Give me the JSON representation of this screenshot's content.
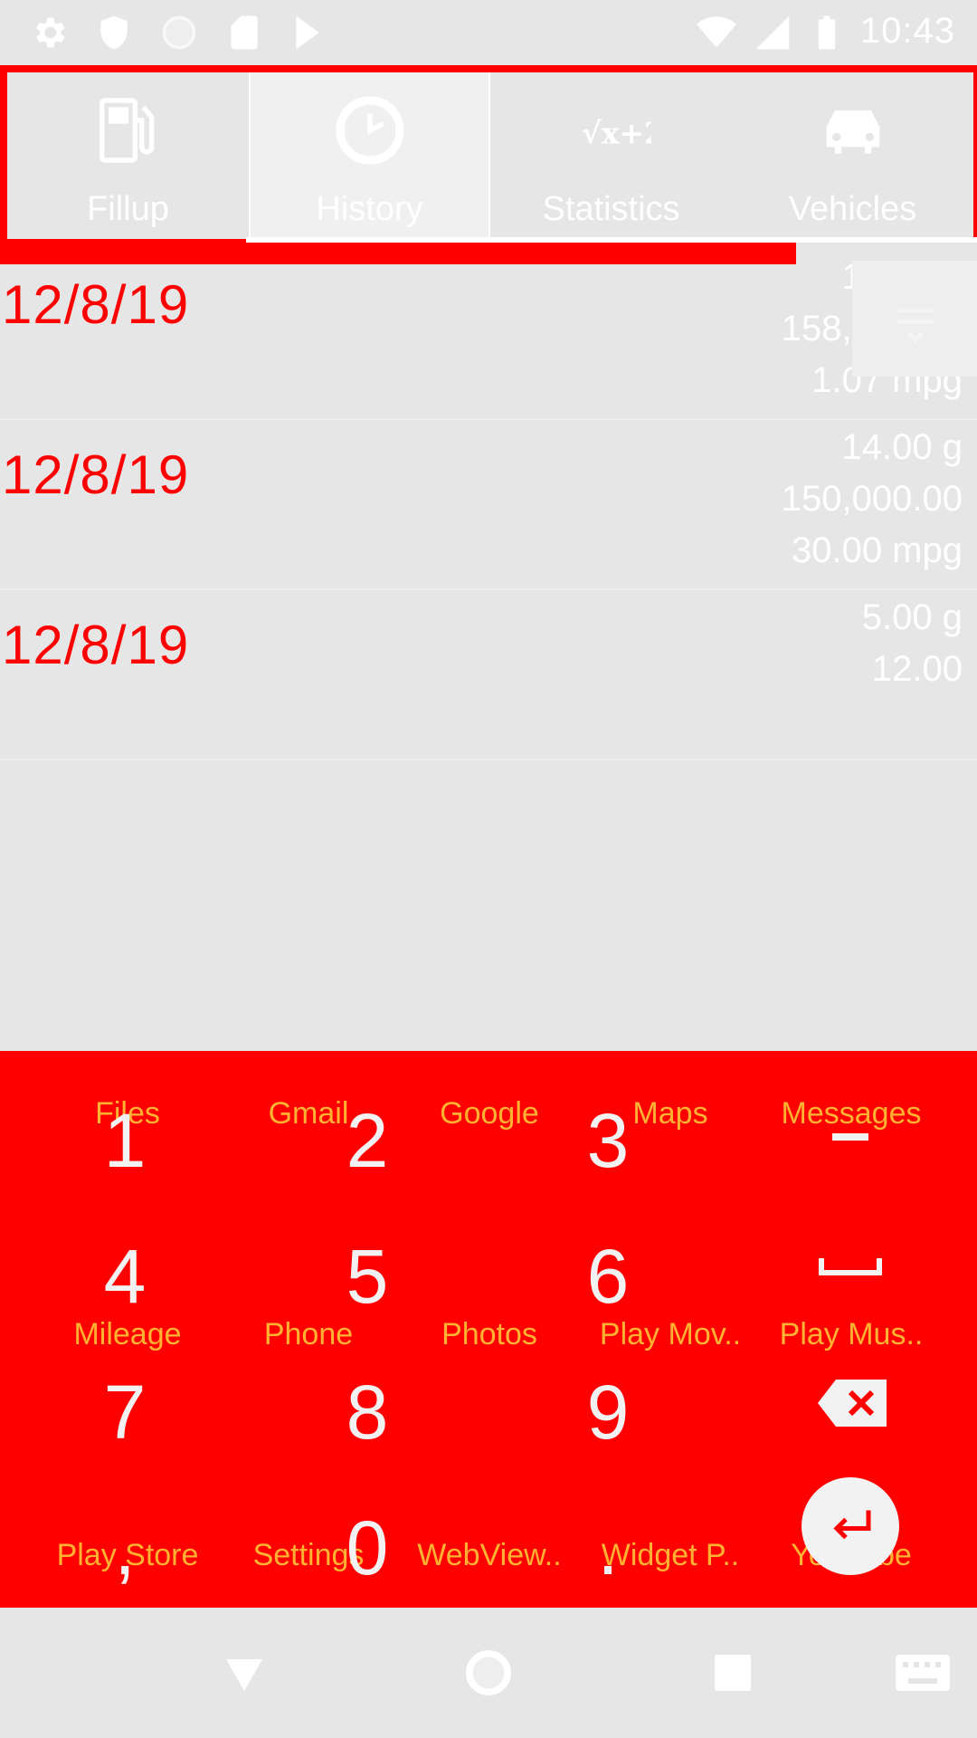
{
  "status_bar": {
    "time": "10:43",
    "icons": [
      "gear-icon",
      "shield-icon",
      "circle-icon",
      "sd-card-icon",
      "play-store-icon",
      "wifi-icon",
      "signal-icon",
      "battery-icon"
    ]
  },
  "tabs": [
    {
      "label": "Fillup",
      "icon": "fuel-pump-icon",
      "active": false
    },
    {
      "label": "History",
      "icon": "clock-icon",
      "active": true
    },
    {
      "label": "Statistics",
      "icon": "formula-icon",
      "active": false
    },
    {
      "label": "Vehicles",
      "icon": "car-icon",
      "active": false
    }
  ],
  "history": [
    {
      "date": "12/8/19",
      "gallons": "15.00 g",
      "odometer": "158,000.00",
      "mpg": "1.07 mpg"
    },
    {
      "date": "12/8/19",
      "gallons": "14.00 g",
      "odometer": "150,000.00",
      "mpg": "30.00 mpg"
    },
    {
      "date": "12/8/19",
      "gallons": "5.00 g",
      "odometer": "12.00",
      "mpg": ""
    }
  ],
  "keyboard": {
    "keys": [
      "1",
      "2",
      "3",
      "4",
      "5",
      "6",
      "7",
      "8",
      "9",
      ",",
      "0",
      "."
    ],
    "background_labels": [
      "Files",
      "Gmail",
      "Google",
      "Maps",
      "Messages",
      "Mileage",
      "Phone",
      "Photos",
      "Play Mov..",
      "Play Mus..",
      "Play Store",
      "Settings",
      "WebView..",
      "Widget P..",
      "YouTube"
    ]
  },
  "colors": {
    "accent": "#ff0000",
    "background": "#e6e6e6",
    "text_light": "#ffffff"
  }
}
